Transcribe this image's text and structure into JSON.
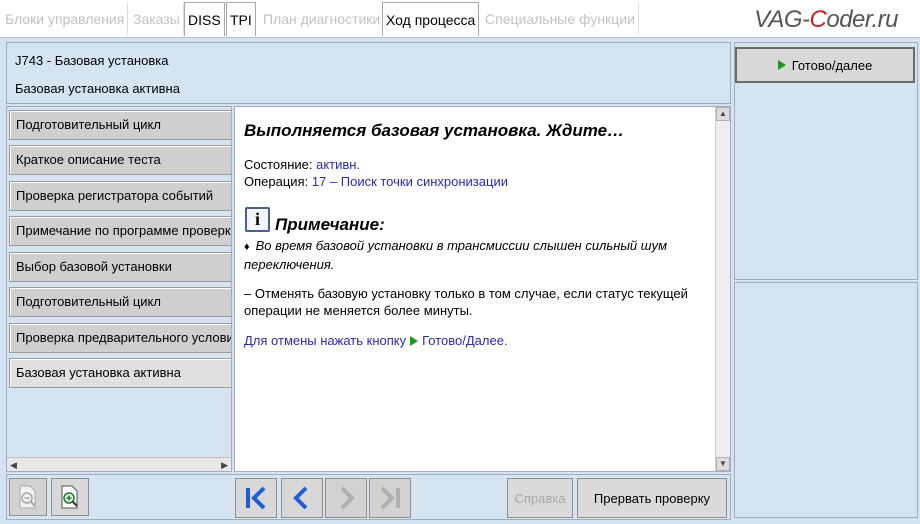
{
  "tabs": [
    {
      "label": "Блоки управления"
    },
    {
      "label": "Заказы"
    },
    {
      "label": "DISS"
    },
    {
      "label": "TPI"
    },
    {
      "label": "План диагностики"
    },
    {
      "label": "Ход процесса"
    },
    {
      "label": "Специальные функции"
    }
  ],
  "watermark": {
    "part1": "VAG-",
    "part2": "C",
    "part3": "oder.ru"
  },
  "header": {
    "title": "J743 - Базовая установка",
    "status": "Базовая установка активна"
  },
  "right": {
    "done_button": "Готово/далее"
  },
  "steps": [
    {
      "label": "Подготовительный цикл"
    },
    {
      "label": "Краткое описание теста"
    },
    {
      "label": "Проверка регистратора событий"
    },
    {
      "label": "Примечание по программе проверки"
    },
    {
      "label": "Выбор базовой установки"
    },
    {
      "label": "Подготовительный цикл"
    },
    {
      "label": "Проверка предварительного условия"
    },
    {
      "label": "Базовая установка активна"
    }
  ],
  "content": {
    "heading": "Выполняется базовая установка. Ждите…",
    "state_label": "Состояние:",
    "state_value": "активн.",
    "operation_label": "Операция:",
    "operation_value": "17 – Поиск точки синхронизации",
    "note_icon_glyph": "i",
    "note_title": "Примечание:",
    "bullet_glyph": "♦",
    "bullet_text": "Во время базовой установки в трансмиссии слышен сильный шум переключения.",
    "paragraph": "– Отменять базовую установку только в том случае, если статус текущей операции не меняется более минуты.",
    "cancel_text": "Для отмены нажать кнопку",
    "cancel_target": "Готово/Далее."
  },
  "toolbar": {
    "help_label": "Справка",
    "abort_label": "Прервать проверку"
  },
  "colors": {
    "accent_blue": "#2a2ab8",
    "go_green": "#1a9a1a",
    "nav_blue": "#1f5fd6"
  }
}
